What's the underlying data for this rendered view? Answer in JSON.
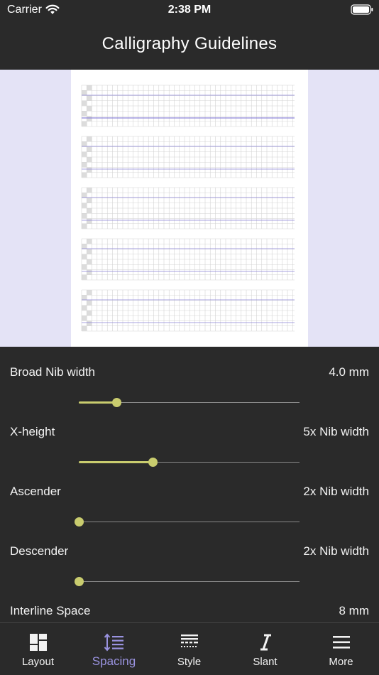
{
  "status_bar": {
    "carrier": "Carrier",
    "time": "2:38 PM"
  },
  "nav": {
    "title": "Calligraphy Guidelines"
  },
  "colors": {
    "accent": "#c9cc6e",
    "active_tab": "#9a93e0",
    "background": "#2a2a2a",
    "preview_bg": "#e4e3f6"
  },
  "settings": [
    {
      "label": "Broad Nib width",
      "value": "4.0 mm",
      "level": 0.17
    },
    {
      "label": "X-height",
      "value": "5x Nib width",
      "level": 0.335
    },
    {
      "label": "Ascender",
      "value": "2x Nib width",
      "level": 0.0
    },
    {
      "label": "Descender",
      "value": "2x Nib width",
      "level": 0.0
    },
    {
      "label": "Interline Space",
      "value": "8 mm"
    }
  ],
  "tabs": [
    {
      "label": "Layout",
      "icon": "layout-icon",
      "active": false
    },
    {
      "label": "Spacing",
      "icon": "spacing-icon",
      "active": true
    },
    {
      "label": "Style",
      "icon": "style-icon",
      "active": false
    },
    {
      "label": "Slant",
      "icon": "slant-icon",
      "active": false
    },
    {
      "label": "More",
      "icon": "more-icon",
      "active": false
    }
  ]
}
